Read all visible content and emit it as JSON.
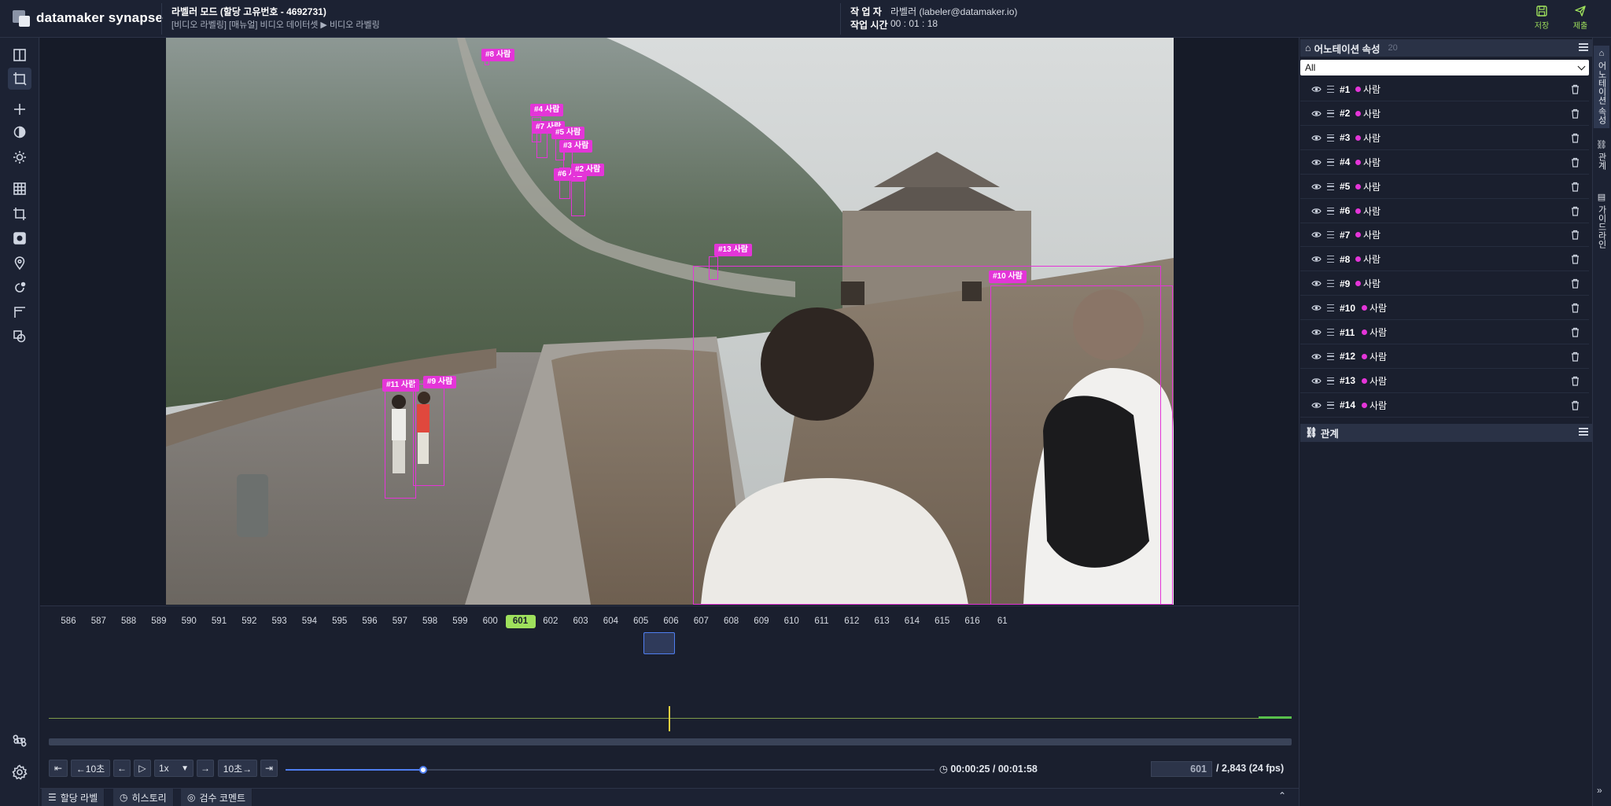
{
  "app": {
    "logo_text": "datamaker synapse"
  },
  "header": {
    "mode_title": "라벨러 모드  (할당 고유번호 - 4692731)",
    "path": "[비디오 라벨링] [매뉴얼] 비디오 데이터셋 ▶ 비디오 라벨링",
    "worker_label": "작 업 자",
    "worker_value": "라벨러 (labeler@datamaker.io)",
    "time_label": "작업 시간",
    "time_value": "00 : 01 : 18",
    "save_label": "저장",
    "submit_label": "제출"
  },
  "left_tools": [
    {
      "name": "layout-icon"
    },
    {
      "name": "bbox-tool-icon"
    },
    {
      "name": "crosshair-icon"
    },
    {
      "name": "contrast-icon"
    },
    {
      "name": "brightness-icon"
    },
    {
      "name": "grid-icon"
    },
    {
      "name": "crop-icon"
    },
    {
      "name": "mask-icon"
    },
    {
      "name": "pin-icon"
    },
    {
      "name": "rotate-icon"
    },
    {
      "name": "ruler-icon"
    },
    {
      "name": "copy-icon"
    },
    {
      "name": "shortcut-icon"
    },
    {
      "name": "settings-icon"
    }
  ],
  "annotations_on_canvas": [
    {
      "tag": "#8 사람"
    },
    {
      "tag": "#4 사람"
    },
    {
      "tag": "#7 사람"
    },
    {
      "tag": "#5 사람"
    },
    {
      "tag": "#3 사람"
    },
    {
      "tag": "#6 사람"
    },
    {
      "tag": "#2 사람"
    },
    {
      "tag": "#13 사람"
    },
    {
      "tag": "#11 사람"
    },
    {
      "tag": "#9 사람"
    },
    {
      "tag": "#10 사람"
    }
  ],
  "timeline": {
    "frames": [
      "586",
      "587",
      "588",
      "589",
      "590",
      "591",
      "592",
      "593",
      "594",
      "595",
      "596",
      "597",
      "598",
      "599",
      "600",
      "601",
      "602",
      "603",
      "604",
      "605",
      "606",
      "607",
      "608",
      "609",
      "610",
      "611",
      "612",
      "613",
      "614",
      "615",
      "616",
      "61"
    ],
    "current_frame": "601",
    "back_10s": "←10초",
    "fwd_10s": "10초→",
    "speed": "1x",
    "time_display": "00:00:25 / 00:01:58",
    "frame_input": "601",
    "frame_total": "/ 2,843 (24 fps)",
    "seek_progress": 0.212
  },
  "bottom_tabs": [
    {
      "label": "할당 라벨"
    },
    {
      "label": "히스토리"
    },
    {
      "label": "검수 코멘트"
    }
  ],
  "right_panel": {
    "title": "어노테이션 속성",
    "count": "20",
    "filter_value": "All",
    "items": [
      {
        "id": "#1",
        "cls": "사람"
      },
      {
        "id": "#2",
        "cls": "사람"
      },
      {
        "id": "#3",
        "cls": "사람"
      },
      {
        "id": "#4",
        "cls": "사람"
      },
      {
        "id": "#5",
        "cls": "사람"
      },
      {
        "id": "#6",
        "cls": "사람"
      },
      {
        "id": "#7",
        "cls": "사람"
      },
      {
        "id": "#8",
        "cls": "사람"
      },
      {
        "id": "#9",
        "cls": "사람"
      },
      {
        "id": "#10",
        "cls": "사람"
      },
      {
        "id": "#11",
        "cls": "사람"
      },
      {
        "id": "#12",
        "cls": "사람"
      },
      {
        "id": "#13",
        "cls": "사람"
      },
      {
        "id": "#14",
        "cls": "사람"
      }
    ],
    "relation_title": "관계"
  },
  "vertical_tabs": [
    {
      "label": "어노테이션 속성"
    },
    {
      "label": "관계"
    },
    {
      "label": "가이드라인"
    }
  ],
  "colors": {
    "accent": "#9ee05c",
    "annotation": "#e435d8",
    "primary": "#4f7ef0"
  }
}
